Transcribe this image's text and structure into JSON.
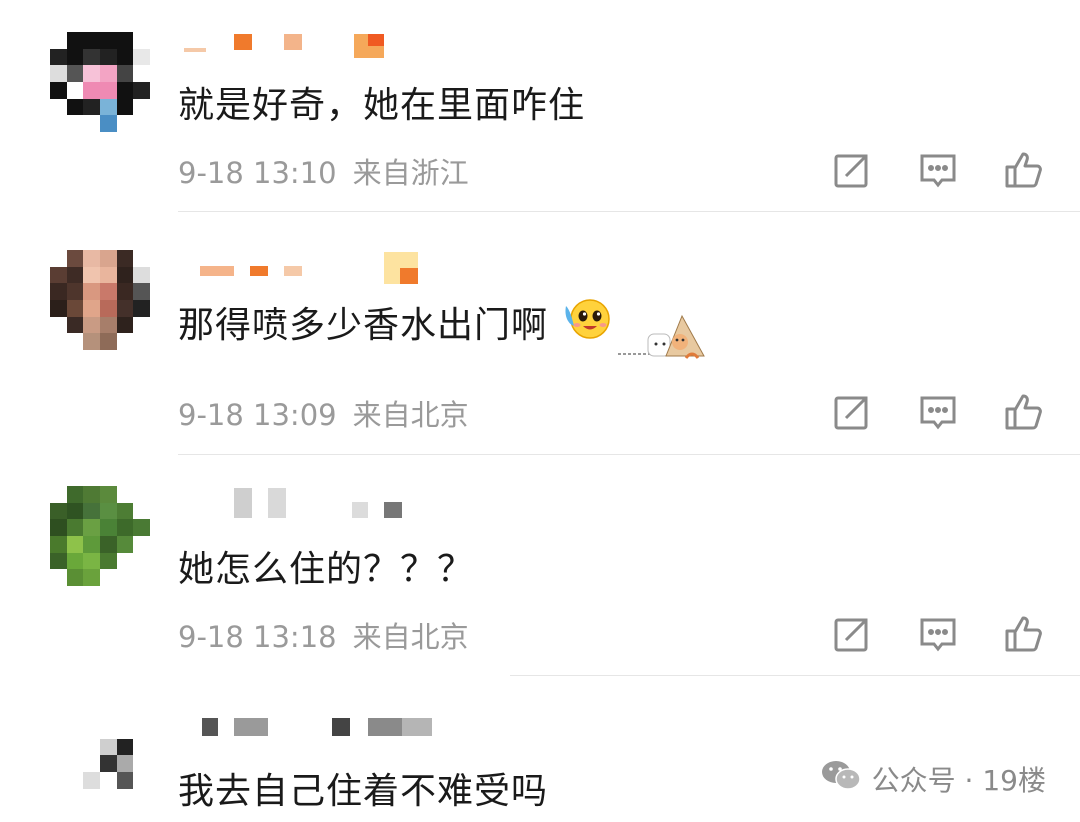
{
  "comments": [
    {
      "text": "就是好奇，她在里面咋住",
      "date": "9-18 13:10",
      "location": "来自浙江"
    },
    {
      "text": "那得喷多少香水出门啊",
      "date": "9-18 13:09",
      "location": "来自北京"
    },
    {
      "text": "她怎么住的？？？",
      "date": "9-18 13:18",
      "location": "来自北京"
    },
    {
      "text": "我去自己住着不难受吗"
    }
  ],
  "icons": {
    "share": "share-icon",
    "comment": "comment-icon",
    "like": "thumbs-up-icon",
    "emoji": "crying-laugh-emoji-icon",
    "wechat": "wechat-icon"
  },
  "watermark": {
    "text": "公众号 · 19楼"
  },
  "colors": {
    "text": "#1a1a1a",
    "meta": "#9a9a9a",
    "icon": "#8a8a8a",
    "username_accent": "#f08a3c"
  }
}
